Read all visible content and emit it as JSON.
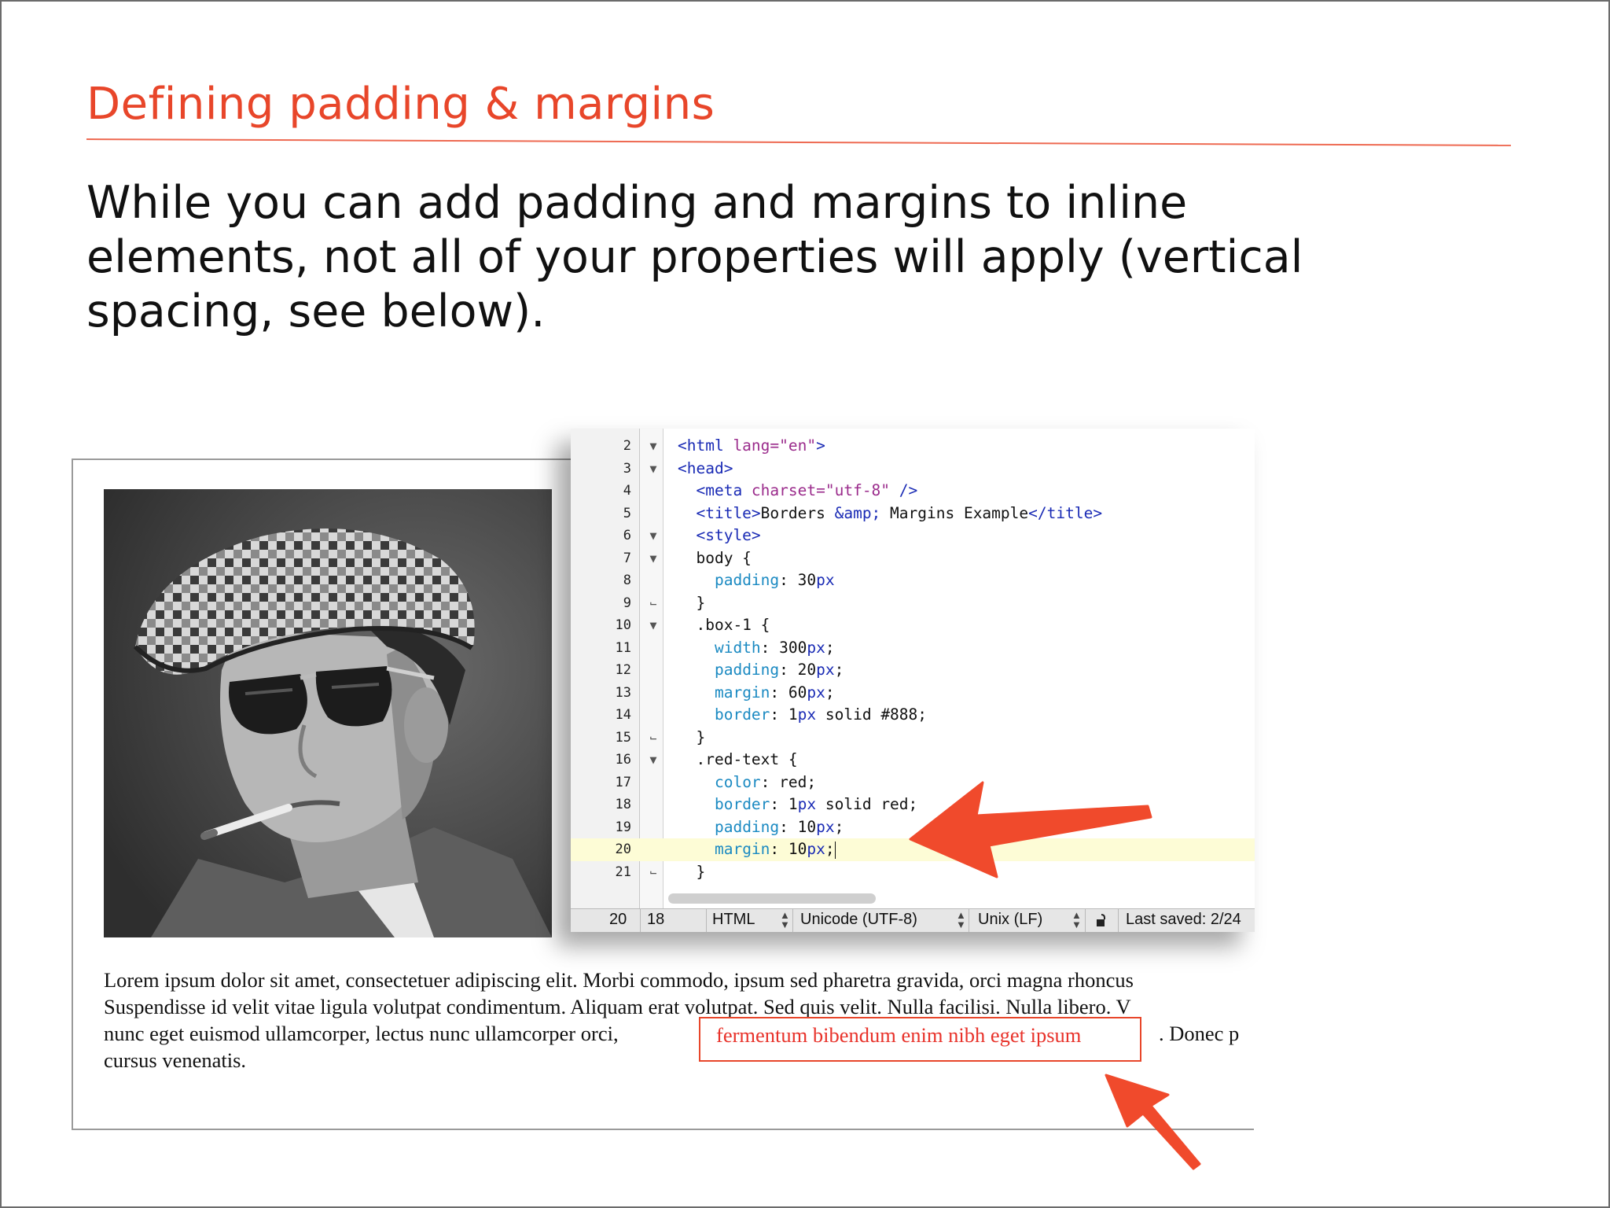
{
  "slide": {
    "title": "Defining padding & margins",
    "body_lines": [
      "While you can add padding and margins to inline",
      "elements, not all of your properties will apply (vertical",
      "spacing, see below)."
    ]
  },
  "editor": {
    "lines": [
      {
        "n": "2",
        "fold": "▼"
      },
      {
        "n": "3",
        "fold": "▼"
      },
      {
        "n": "4",
        "fold": ""
      },
      {
        "n": "5",
        "fold": ""
      },
      {
        "n": "6",
        "fold": "▼"
      },
      {
        "n": "7",
        "fold": "▼"
      },
      {
        "n": "8",
        "fold": ""
      },
      {
        "n": "9",
        "fold": "⌙"
      },
      {
        "n": "10",
        "fold": "▼"
      },
      {
        "n": "11",
        "fold": ""
      },
      {
        "n": "12",
        "fold": ""
      },
      {
        "n": "13",
        "fold": ""
      },
      {
        "n": "14",
        "fold": ""
      },
      {
        "n": "15",
        "fold": "⌙"
      },
      {
        "n": "16",
        "fold": "▼"
      },
      {
        "n": "17",
        "fold": ""
      },
      {
        "n": "18",
        "fold": ""
      },
      {
        "n": "19",
        "fold": ""
      },
      {
        "n": "20",
        "fold": ""
      },
      {
        "n": "21",
        "fold": "⌙"
      }
    ],
    "code": {
      "l2_open": "<html",
      "l2_attr": " lang=",
      "l2_val": "\"en\"",
      "l2_close": ">",
      "l3": "<head>",
      "l4_open": "<meta",
      "l4_attr": " charset=",
      "l4_val": "\"utf-8\"",
      "l4_close": " />",
      "l5_open": "<title>",
      "l5_text1": "Borders ",
      "l5_entity": "&amp;",
      "l5_text2": " Margins Example",
      "l5_close": "</title>",
      "l6": "<style>",
      "l7": "body {",
      "l8_prop": "padding",
      "l8_colon": ": ",
      "l8_num": "30",
      "l8_unit": "px",
      "l9": "}",
      "l10": ".box-1 {",
      "l11_prop": "width",
      "l11_num": "300",
      "l12_prop": "padding",
      "l12_num": "20",
      "l13_prop": "margin",
      "l13_num": "60",
      "l14_prop": "border",
      "l14_num": "1",
      "l14_rest": " solid #888;",
      "l15": "}",
      "l16": ".red-text {",
      "l17_prop": "color",
      "l17_rest": ": red;",
      "l18_prop": "border",
      "l18_num": "1",
      "l18_rest": " solid red;",
      "l19_prop": "padding",
      "l19_num": "10",
      "l20_prop": "margin",
      "l20_num": "10",
      "l21": "}",
      "unit_px": "px",
      "semicolon": ";",
      "colon": ": "
    },
    "status": {
      "line": "20",
      "col": "18",
      "language": "HTML",
      "encoding": "Unicode (UTF-8)",
      "line_endings": "Unix (LF)",
      "last_saved": "Last saved: 2/24"
    }
  },
  "page": {
    "lorem_line1": "Lorem ipsum dolor sit amet, consectetuer adipiscing elit. Morbi commodo, ipsum sed pharetra gravida, orci magna rhoncus",
    "lorem_line2": "Suspendisse id velit vitae ligula volutpat condimentum. Aliquam erat volutpat. Sed quis velit. Nulla facilisi. Nulla libero. V",
    "lorem_line3_start": "nunc eget euismod ullamcorper, lectus nunc ullamcorper orci,",
    "red_text": "fermentum bibendum enim nibh eget ipsum",
    "lorem_line3_end": ". Donec p",
    "lorem_line4": "cursus venenatis."
  },
  "colors": {
    "accent": "#e8462a",
    "arrow": "#f04a2c",
    "tag": "#1a2bb5",
    "attr": "#9b2c8c",
    "prop": "#1b8ac2",
    "highlight": "#fdfcd6"
  },
  "icons": {
    "arrow_editor": "arrow-icon",
    "arrow_text": "arrow-icon",
    "lock": "lock-icon"
  }
}
